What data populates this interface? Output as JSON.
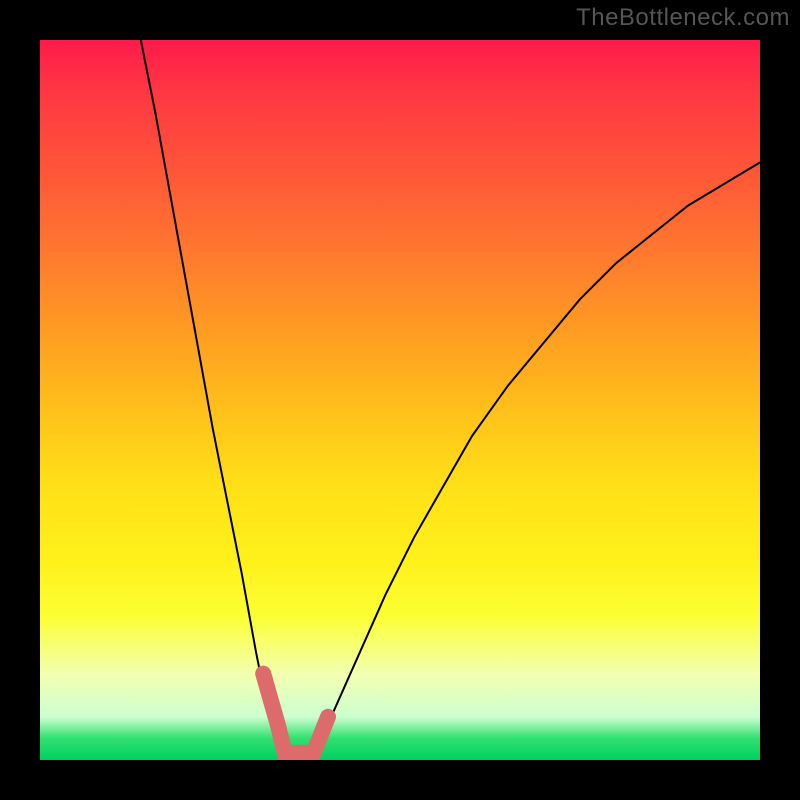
{
  "watermark": "TheBottleneck.com",
  "colors": {
    "page_bg": "#000000",
    "accent": "#dd6b6b",
    "gradient_top": "#ff1a4a",
    "gradient_bottom": "#00d060"
  },
  "chart_data": {
    "type": "line",
    "title": "",
    "xlabel": "",
    "ylabel": "",
    "xlim": [
      0,
      100
    ],
    "ylim": [
      0,
      100
    ],
    "series": [
      {
        "name": "left-curve",
        "x": [
          14,
          16,
          18,
          20,
          22,
          24,
          26,
          28,
          30,
          31,
          32,
          33,
          34
        ],
        "y": [
          100,
          90,
          79,
          68,
          57,
          46,
          36,
          26,
          15,
          10,
          6,
          3,
          0
        ]
      },
      {
        "name": "right-curve",
        "x": [
          38,
          40,
          44,
          48,
          52,
          56,
          60,
          65,
          70,
          75,
          80,
          85,
          90,
          95,
          100
        ],
        "y": [
          0,
          5,
          14,
          23,
          31,
          38,
          45,
          52,
          58,
          64,
          69,
          73,
          77,
          80,
          83
        ]
      },
      {
        "name": "accent-segment",
        "x": [
          31,
          33,
          34,
          36,
          38,
          40
        ],
        "y": [
          12,
          5,
          1,
          1,
          1,
          6
        ]
      }
    ]
  }
}
